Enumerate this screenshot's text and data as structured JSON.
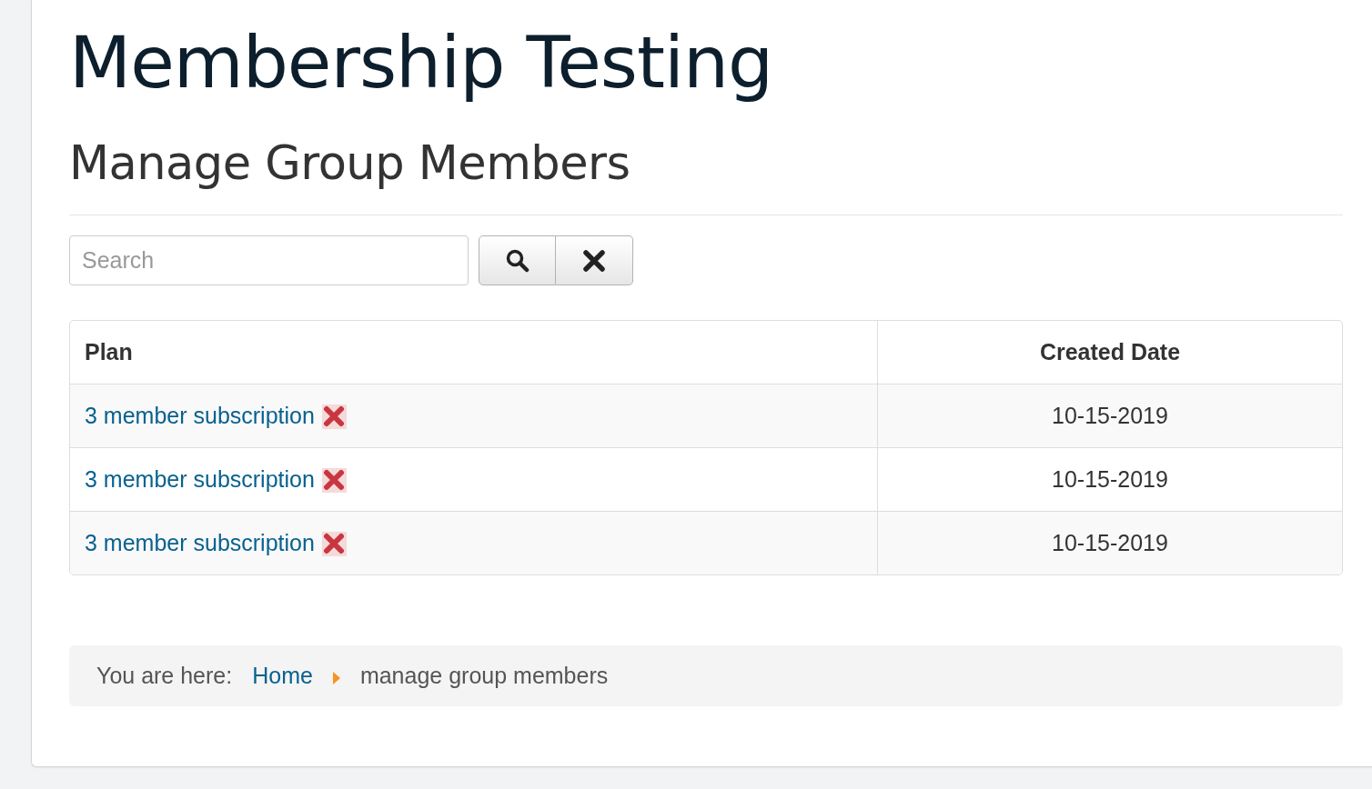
{
  "title": "Membership Testing",
  "subtitle": "Manage Group Members",
  "search": {
    "placeholder": "Search"
  },
  "table": {
    "columns": [
      "Plan",
      "Created Date"
    ],
    "rows": [
      {
        "plan": "3 member subscription",
        "created": "10-15-2019"
      },
      {
        "plan": "3 member subscription",
        "created": "10-15-2019"
      },
      {
        "plan": "3 member subscription",
        "created": "10-15-2019"
      }
    ]
  },
  "breadcrumb": {
    "label": "You are here:",
    "items": [
      {
        "text": "Home",
        "link": true
      },
      {
        "text": "manage group members",
        "link": false
      }
    ]
  }
}
